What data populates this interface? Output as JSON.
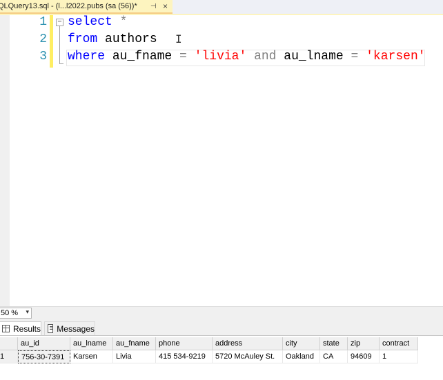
{
  "tab": {
    "title": "QLQuery13.sql - (l...l2022.pubs (sa (56))*",
    "pin_icon": "pin-icon",
    "close_glyph": "×"
  },
  "editor": {
    "line_numbers": [
      "1",
      "2",
      "3"
    ],
    "line1": {
      "kw": "select",
      "rest": " *"
    },
    "line2": {
      "kw": "from",
      "rest": " authors"
    },
    "line3": {
      "kw_where": "where",
      "col1": " au_fname ",
      "eq1": "=",
      "val1": " 'livia' ",
      "kw_and": "and",
      "col2": " au_lname ",
      "eq2": "=",
      "val2": " 'karsen'"
    },
    "fold_glyph": "−",
    "cursor_glyph": "I"
  },
  "zoom": {
    "value": "50 %",
    "arrow": "▾"
  },
  "results_tabs": {
    "results": "Results",
    "messages": "Messages"
  },
  "grid": {
    "columns": [
      "au_id",
      "au_lname",
      "au_fname",
      "phone",
      "address",
      "city",
      "state",
      "zip",
      "contract"
    ],
    "rows": [
      {
        "rownum": "1",
        "cells": [
          "756-30-7391",
          "Karsen",
          "Livia",
          "415 534-9219",
          "5720 McAuley St.",
          "Oakland",
          "CA",
          "94609",
          "1"
        ]
      }
    ]
  },
  "colors": {
    "keyword": "#0000ff",
    "string": "#ff0000",
    "operator": "#808080",
    "line_number": "#2b91af",
    "tab_active": "#fdf4bf",
    "change_bar": "#ffee62"
  }
}
